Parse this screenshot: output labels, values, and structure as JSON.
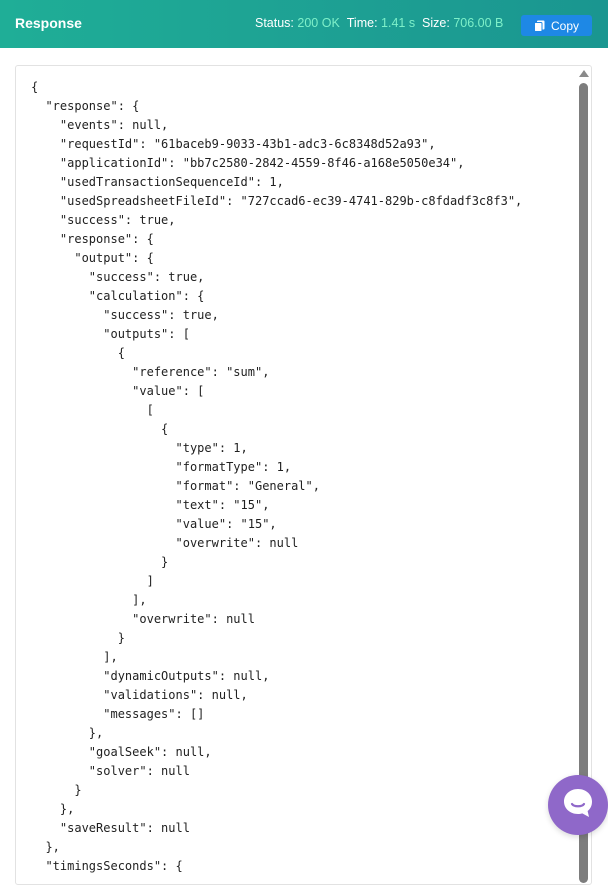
{
  "header": {
    "title": "Response",
    "status_label": "Status:",
    "status_value": "200 OK",
    "time_label": "Time:",
    "time_value": "1.41 s",
    "size_label": "Size:",
    "size_value": "706.00 B",
    "copy_label": "Copy"
  },
  "colors": {
    "header_bg": "#1fae97",
    "stat_value": "#7ef0c9",
    "copy_button": "#1e88e5",
    "chat_button": "#8f68c9"
  },
  "icons": {
    "copy": "copy-icon",
    "chat": "chat-bubble-icon"
  },
  "json_lines": [
    "{",
    "  \"response\": {",
    "    \"events\": null,",
    "    \"requestId\": \"61baceb9-9033-43b1-adc3-6c8348d52a93\",",
    "    \"applicationId\": \"bb7c2580-2842-4559-8f46-a168e5050e34\",",
    "    \"usedTransactionSequenceId\": 1,",
    "    \"usedSpreadsheetFileId\": \"727ccad6-ec39-4741-829b-c8fdadf3c8f3\",",
    "    \"success\": true,",
    "    \"response\": {",
    "      \"output\": {",
    "        \"success\": true,",
    "        \"calculation\": {",
    "          \"success\": true,",
    "          \"outputs\": [",
    "            {",
    "              \"reference\": \"sum\",",
    "              \"value\": [",
    "                [",
    "                  {",
    "                    \"type\": 1,",
    "                    \"formatType\": 1,",
    "                    \"format\": \"General\",",
    "                    \"text\": \"15\",",
    "                    \"value\": \"15\",",
    "                    \"overwrite\": null",
    "                  }",
    "                ]",
    "              ],",
    "              \"overwrite\": null",
    "            }",
    "          ],",
    "          \"dynamicOutputs\": null,",
    "          \"validations\": null,",
    "          \"messages\": []",
    "        },",
    "        \"goalSeek\": null,",
    "        \"solver\": null",
    "      }",
    "    },",
    "    \"saveResult\": null",
    "  },",
    "  \"timingsSeconds\": {"
  ]
}
